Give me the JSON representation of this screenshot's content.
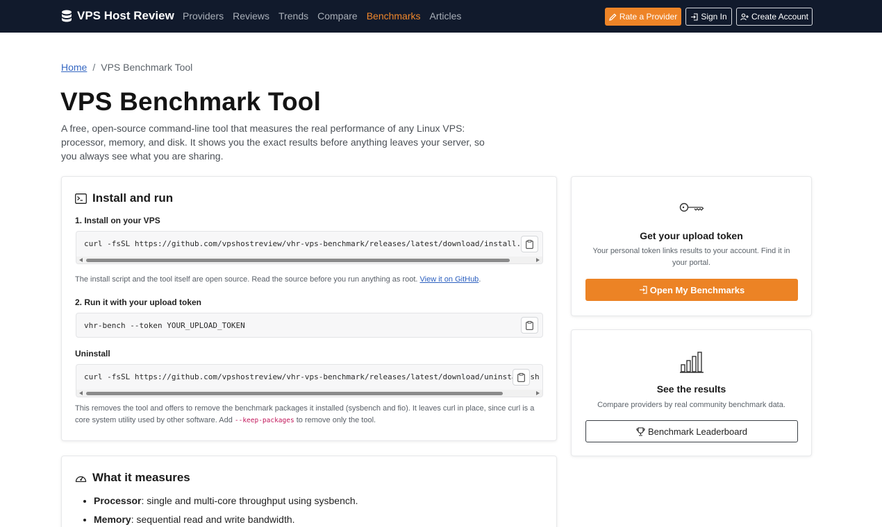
{
  "nav": {
    "brand": "VPS Host Review",
    "links": [
      "Providers",
      "Reviews",
      "Trends",
      "Compare",
      "Benchmarks",
      "Articles"
    ],
    "rate_label": "Rate a Provider",
    "signin_label": "Sign In",
    "create_label": "Create Account"
  },
  "breadcrumb": {
    "home": "Home",
    "current": "VPS Benchmark Tool"
  },
  "page": {
    "title": "VPS Benchmark Tool",
    "lead": "A free, open-source command-line tool that measures the real performance of any Linux VPS: processor, memory, and disk. It shows you the exact results before anything leaves your server, so you always see what you are sharing."
  },
  "install": {
    "title": "Install and run",
    "step1_label": "1. Install on your VPS",
    "step1_code": "curl -fsSL https://github.com/vpshostreview/vhr-vps-benchmark/releases/latest/download/install.sh | sudo",
    "step1_note": "The install script and the tool itself are open source. Read the source before you run anything as root.",
    "step1_link": "View it on GitHub",
    "step1_after": ".",
    "step2_label": "2. Run it with your upload token",
    "step2_code": "vhr-bench --token YOUR_UPLOAD_TOKEN",
    "uninstall_label": "Uninstall",
    "uninstall_code": "curl -fsSL https://github.com/vpshostreview/vhr-vps-benchmark/releases/latest/download/uninstall.sh | sudo s",
    "uninstall_note_1": "This removes the tool and offers to remove the benchmark packages it installed (sysbench and fio). It leaves curl in place, since curl is a core system utility used by other software. Add",
    "uninstall_flag": "--keep-packages",
    "uninstall_note_2": "to remove only the tool."
  },
  "measures": {
    "title": "What it measures",
    "items": [
      {
        "term": "Processor",
        "desc": ": single and multi-core throughput using sysbench."
      },
      {
        "term": "Memory",
        "desc": ": sequential read and write bandwidth."
      }
    ]
  },
  "token_card": {
    "title": "Get your upload token",
    "desc": "Your personal token links results to your account. Find it in your portal.",
    "button": "Open My Benchmarks"
  },
  "results_card": {
    "title": "See the results",
    "desc": "Compare providers by real community benchmark data.",
    "button": "Benchmark Leaderboard"
  },
  "colors": {
    "navbar": "#111a2c",
    "accent": "#ec8325",
    "link": "#3567c2"
  }
}
